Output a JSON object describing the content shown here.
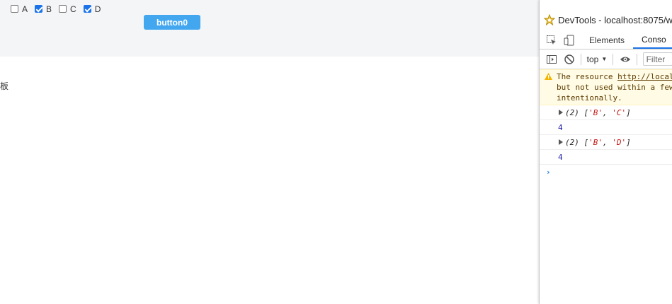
{
  "page": {
    "checkboxes": [
      {
        "label": "A",
        "checked": false
      },
      {
        "label": "B",
        "checked": true
      },
      {
        "label": "C",
        "checked": false
      },
      {
        "label": "D",
        "checked": true
      }
    ],
    "button_label": "button0",
    "side_text": "板"
  },
  "devtools": {
    "title": "DevTools - localhost:8075/w",
    "tabs": [
      "Elements",
      "Conso"
    ],
    "active_tab": "Conso",
    "context": "top",
    "filter_placeholder": "Filter",
    "messages": {
      "warning_prefix": "The resource ",
      "warning_link": "http://local",
      "warning_rest": "but not used within a few",
      "warning_end": "intentionally.",
      "log1_prefix": "(2) [",
      "log1_items": [
        "'B'",
        "'C'"
      ],
      "log1_count": "4",
      "log2_items": [
        "'B'",
        "'D'"
      ],
      "log2_count": "4"
    }
  }
}
